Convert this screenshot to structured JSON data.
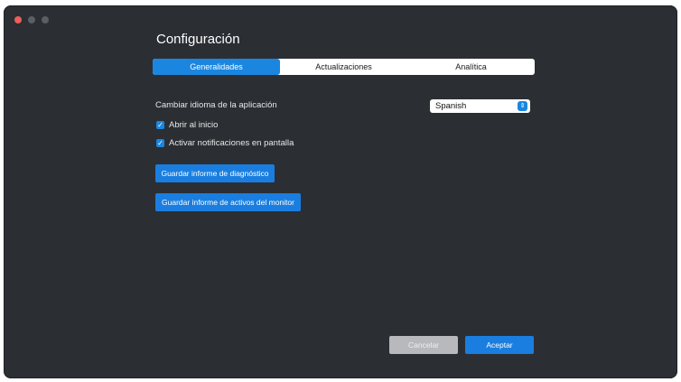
{
  "window": {
    "title": "Configuración"
  },
  "tabs": [
    {
      "label": "Generalidades",
      "active": true
    },
    {
      "label": "Actualizaciones",
      "active": false
    },
    {
      "label": "Analítica",
      "active": false
    }
  ],
  "language": {
    "label": "Cambiar idioma de la aplicación",
    "selected": "Spanish"
  },
  "options": [
    {
      "label": "Abrir al inicio",
      "checked": true
    },
    {
      "label": "Activar notificaciones en pantalla",
      "checked": true
    }
  ],
  "buttons": {
    "diagnostic": "Guardar informe de diagnóstico",
    "assets": "Guardar informe de activos del monitor",
    "cancel": "Cancelar",
    "accept": "Aceptar"
  },
  "colors": {
    "background": "#2b2e33",
    "accent": "#1a86e0",
    "close": "#ec5f57"
  }
}
